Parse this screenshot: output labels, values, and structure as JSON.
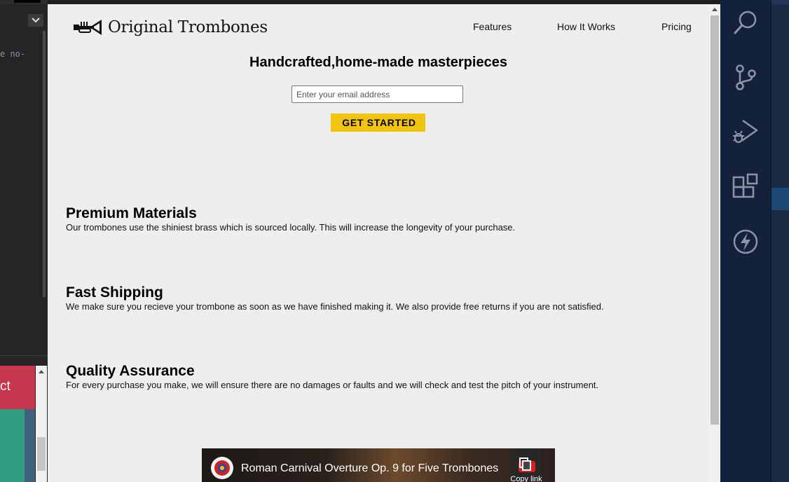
{
  "editor": {
    "code_fragment": "e no-",
    "panel_button_label": "ct"
  },
  "site": {
    "logo_text": "Original Trombones",
    "nav": [
      "Features",
      "How It Works",
      "Pricing"
    ],
    "hero": {
      "title": "Handcrafted,home-made masterpieces",
      "email_placeholder": "Enter your email address",
      "cta_label": "GET STARTED"
    },
    "features": [
      {
        "title": "Premium Materials",
        "text": "Our trombones use the shiniest brass which is sourced locally. This will increase the longevity of your purchase."
      },
      {
        "title": "Fast Shipping",
        "text": "We make sure you recieve your trombone as soon as we have finished making it. We also provide free returns if you are not satisfied."
      },
      {
        "title": "Quality Assurance",
        "text": "For every purchase you make, we will ensure there are no damages or faults and we will check and test the pitch of your instrument."
      }
    ],
    "video": {
      "title": "Roman Carnival Overture Op. 9 for Five Trombones",
      "copy_link_label": "Copy link"
    }
  },
  "activity_bar": {
    "icons": [
      "search-icon",
      "source-control-icon",
      "run-debug-icon",
      "extensions-icon",
      "lightning-icon"
    ]
  },
  "colors": {
    "page_background": "#eeeeee",
    "cta_background": "#f1c40f",
    "activity_bar": "#14213a",
    "icon_color": "#8b95a6",
    "panel_red": "#c8364d",
    "panel_green": "#2d9c7f"
  }
}
